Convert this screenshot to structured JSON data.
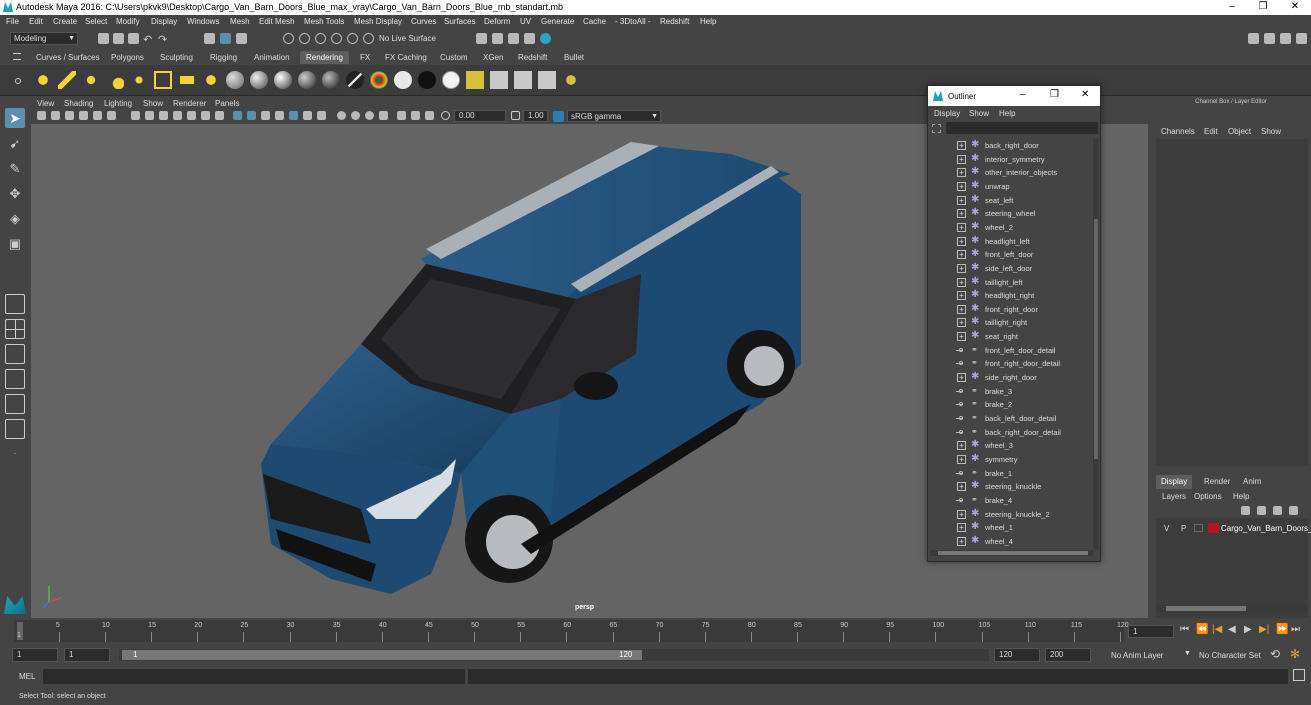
{
  "window": {
    "title": "Autodesk Maya 2016: C:\\Users\\pkvk9\\Desktop\\Cargo_Van_Barn_Doors_Blue_max_vray\\Cargo_Van_Barn_Doors_Blue_mb_standart.mb",
    "minimize": "–",
    "maximize": "❐",
    "close": "✕"
  },
  "menubar": [
    "File",
    "Edit",
    "Create",
    "Select",
    "Modify",
    "Display",
    "Windows",
    "Mesh",
    "Edit Mesh",
    "Mesh Tools",
    "Mesh Display",
    "Curves",
    "Surfaces",
    "Deform",
    "UV",
    "Generate",
    "Cache",
    "- 3DtoAll -",
    "Redshift",
    "Help"
  ],
  "statusline": {
    "mode": "Modeling",
    "live_surface": "No Live Surface"
  },
  "shelf_tabs": [
    "Curves / Surfaces",
    "Polygons",
    "Sculpting",
    "Rigging",
    "Animation",
    "Rendering",
    "FX",
    "FX Caching",
    "Custom",
    "XGen",
    "Redshift",
    "Bullet"
  ],
  "active_shelf": "Rendering",
  "panel_menu": [
    "View",
    "Shading",
    "Lighting",
    "Show",
    "Renderer",
    "Panels"
  ],
  "panel_toolbar": {
    "exposure": "0.00",
    "gamma": "1.00",
    "colorspace": "sRGB gamma"
  },
  "viewport": {
    "camera_label": "persp"
  },
  "outliner": {
    "title": "Outliner",
    "menu": [
      "Display",
      "Show",
      "Help"
    ],
    "items": [
      {
        "name": "back_right_door",
        "type": "mesh"
      },
      {
        "name": "interior_symmetry",
        "type": "mesh"
      },
      {
        "name": "other_interior_objects",
        "type": "mesh"
      },
      {
        "name": "unwrap",
        "type": "mesh"
      },
      {
        "name": "seat_left",
        "type": "mesh"
      },
      {
        "name": "steering_wheel",
        "type": "mesh"
      },
      {
        "name": "wheel_2",
        "type": "mesh"
      },
      {
        "name": "headlight_left",
        "type": "mesh"
      },
      {
        "name": "front_left_door",
        "type": "mesh"
      },
      {
        "name": "side_left_door",
        "type": "mesh"
      },
      {
        "name": "taillight_left",
        "type": "mesh"
      },
      {
        "name": "headlight_right",
        "type": "mesh"
      },
      {
        "name": "front_right_door",
        "type": "mesh"
      },
      {
        "name": "taillight_right",
        "type": "mesh"
      },
      {
        "name": "seat_right",
        "type": "mesh"
      },
      {
        "name": "front_left_door_detail",
        "type": "link"
      },
      {
        "name": "front_right_door_detail",
        "type": "link"
      },
      {
        "name": "side_right_door",
        "type": "mesh"
      },
      {
        "name": "brake_3",
        "type": "link"
      },
      {
        "name": "brake_2",
        "type": "link"
      },
      {
        "name": "back_left_door_detail",
        "type": "link"
      },
      {
        "name": "back_right_door_detail",
        "type": "link"
      },
      {
        "name": "wheel_3",
        "type": "mesh"
      },
      {
        "name": "symmetry",
        "type": "mesh"
      },
      {
        "name": "brake_1",
        "type": "link"
      },
      {
        "name": "steering_knuckle",
        "type": "mesh"
      },
      {
        "name": "brake_4",
        "type": "link"
      },
      {
        "name": "steering_knuckle_2",
        "type": "mesh"
      },
      {
        "name": "wheel_1",
        "type": "mesh"
      },
      {
        "name": "wheel_4",
        "type": "mesh"
      }
    ]
  },
  "channelbox": {
    "header": "Channel Box / Layer Editor",
    "menu": [
      "Channels",
      "Edit",
      "Object",
      "Show"
    ],
    "layer_tabs": [
      "Display",
      "Render",
      "Anim"
    ],
    "active_layer_tab": "Display",
    "layer_menu": [
      "Layers",
      "Options",
      "Help"
    ],
    "layer": {
      "v": "V",
      "p": "P",
      "name": "Cargo_Van_Barn_Doors_",
      "color": "#b3142a"
    }
  },
  "timeline": {
    "ticks": [
      "5",
      "10",
      "15",
      "20",
      "25",
      "30",
      "35",
      "40",
      "45",
      "50",
      "55",
      "60",
      "65",
      "70",
      "75",
      "80",
      "85",
      "90",
      "95",
      "100",
      "105",
      "110",
      "115",
      "120"
    ],
    "start_marker": "1",
    "current_frame": "1"
  },
  "range": {
    "start": "1",
    "start2": "1",
    "slider_start": "1",
    "slider_end": "120",
    "end": "120",
    "end2": "200",
    "anim_layer": "No Anim Layer",
    "char_set": "No Character Set"
  },
  "cmdline": {
    "label": "MEL"
  },
  "helpline": {
    "text": "Select Tool: select an object"
  }
}
